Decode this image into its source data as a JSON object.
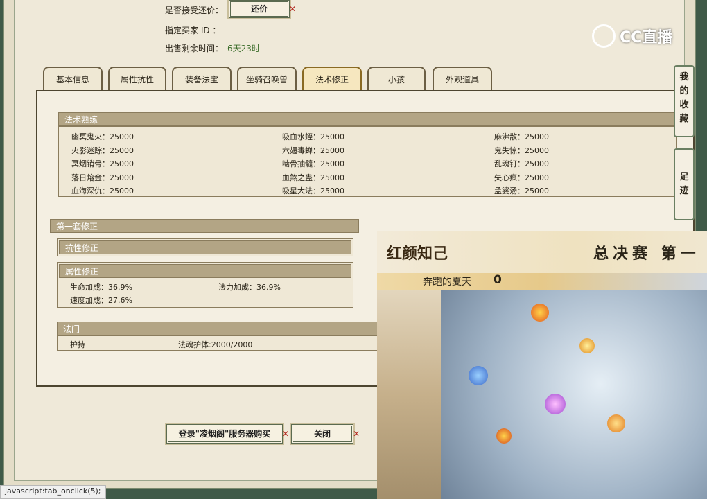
{
  "sale_info": {
    "accept_counter_label": "是否接受还价：",
    "counter_button": "还价",
    "buyer_id_label": "指定买家 ID ：",
    "time_left_label": "出售剩余时间：",
    "time_left_value": "6天23时"
  },
  "logo": {
    "text": "CC直播",
    "icon": "cc-logo-icon"
  },
  "tabs": [
    {
      "label": "基本信息"
    },
    {
      "label": "属性抗性"
    },
    {
      "label": "装备法宝"
    },
    {
      "label": "坐骑召唤兽"
    },
    {
      "label": "法术修正"
    },
    {
      "label": "小孩"
    },
    {
      "label": "外观道具"
    }
  ],
  "active_tab": "法术修正",
  "spell_skill": {
    "title": "法术熟练",
    "rows": [
      [
        "幽冥鬼火：25000",
        "吸血水蛭：25000",
        "麻沸散：25000"
      ],
      [
        "火影迷踪：25000",
        "六翅毒蝉：25000",
        "鬼失惊：25000"
      ],
      [
        "冥烟销骨：25000",
        "啮骨抽髓：25000",
        "乱魂钉：25000"
      ],
      [
        "落日熔金：25000",
        "血煞之蛊：25000",
        "失心疯：25000"
      ],
      [
        "血海深仇：25000",
        "吸星大法：25000",
        "孟婆汤：25000"
      ]
    ]
  },
  "first_set": {
    "title": "第一套修正",
    "resist_title": "抗性修正",
    "attr_title": "属性修正",
    "attrs": [
      "生命加成：36.9%",
      "法力加成：36.9%",
      "速度加成：27.6%"
    ],
    "school_title": "法门",
    "school": [
      "护持",
      "法魂护体:2000/2000"
    ]
  },
  "buttons": {
    "login_buy": "登录\"凌烟阁\"服务器购买",
    "close": "关闭"
  },
  "side": {
    "favorites": "我的收藏",
    "footprints": "足迹"
  },
  "overlay": {
    "title": "红颜知己",
    "subtitle": "总决赛  第一",
    "player_name": "奔跑的夏天",
    "score": "0"
  },
  "status_bar": "javascript:tab_onclick(5);"
}
